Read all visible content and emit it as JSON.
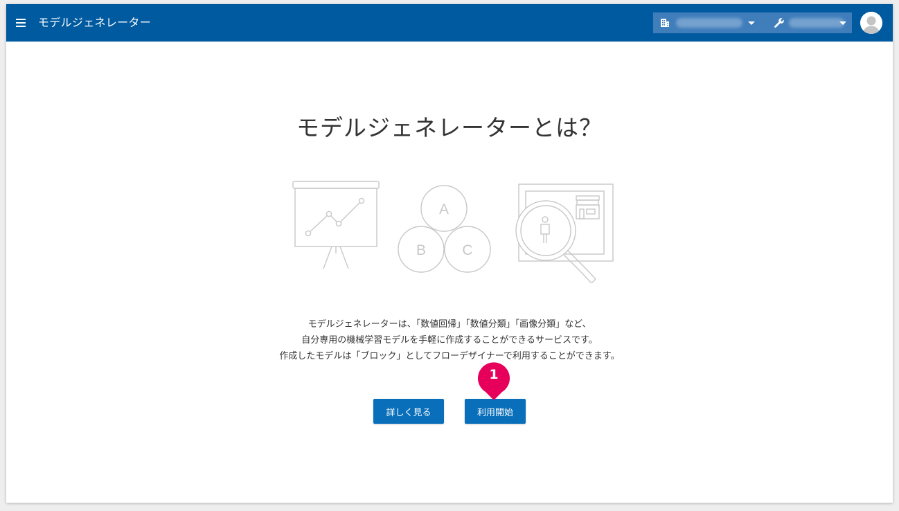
{
  "appbar": {
    "title": "モデルジェネレーター",
    "icons": {
      "menu": "hamburger-menu-icon",
      "organization": "building-icon",
      "tool": "wrench-icon",
      "user": "user-avatar-icon"
    }
  },
  "main": {
    "headline": "モデルジェネレーターとは？",
    "illustration": {
      "circles": [
        "A",
        "B",
        "C"
      ]
    },
    "description": [
      "モデルジェネレーターは、「数値回帰」「数値分類」「画像分類」など、",
      "自分専用の機械学習モデルを手軽に作成することができるサービスです。",
      "作成したモデルは「ブロック」としてフローデザイナーで利用することができます。"
    ],
    "buttons": {
      "more": "詳しく見る",
      "start": "利用開始"
    },
    "marker": "1"
  },
  "colors": {
    "appbar": "#005aa0",
    "crumb": "#3f7dbb",
    "button": "#0a6fba",
    "marker": "#e6005c"
  }
}
